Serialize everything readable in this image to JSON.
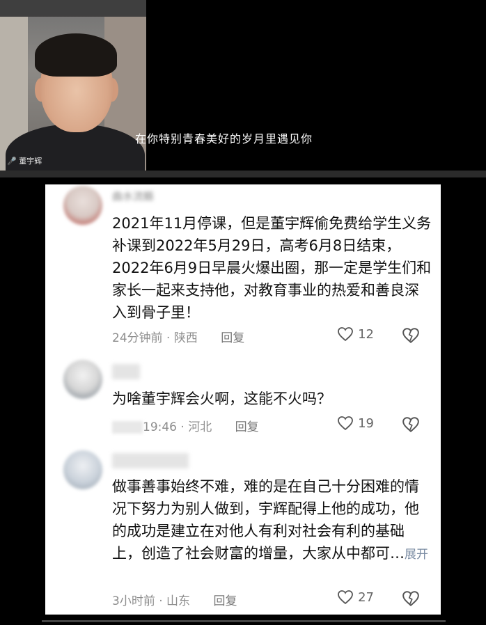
{
  "video": {
    "subtitle": "在你特别青春美好的岁月里遇见你",
    "cam_label": "董宇辉"
  },
  "comments": [
    {
      "username": "曲水流觞",
      "text": "2021年11月停课，但是董宇辉偷免费给学生义务补课到2022年5月29日，高考6月8日结束，2022年6月9日早晨火爆出圈，那一定是学生们和家长一起来支持他，对教育事业的热爱和善良深入到骨子里！",
      "time": "24分钟前",
      "location": "陕西",
      "reply": "回复",
      "likes": "12"
    },
    {
      "username": "",
      "text": "为啥董宇辉会火啊，这能不火吗？",
      "time": "19:46",
      "location": "河北",
      "reply": "回复",
      "likes": "19"
    },
    {
      "username": "",
      "text": "做事善事始终不难，难的是在自己十分困难的情况下努力为别人做到，宇辉配得上他的成功，他的成功是建立在对他人有利对社会有利的基础上，创造了社会财富的增量，大家从中都可…",
      "expand": "展开",
      "time": "3小时前",
      "location": "山东",
      "reply": "回复",
      "likes": "27"
    }
  ],
  "separator": "·",
  "icons": {
    "like": "heart-outline-icon",
    "dislike": "broken-heart-icon"
  }
}
